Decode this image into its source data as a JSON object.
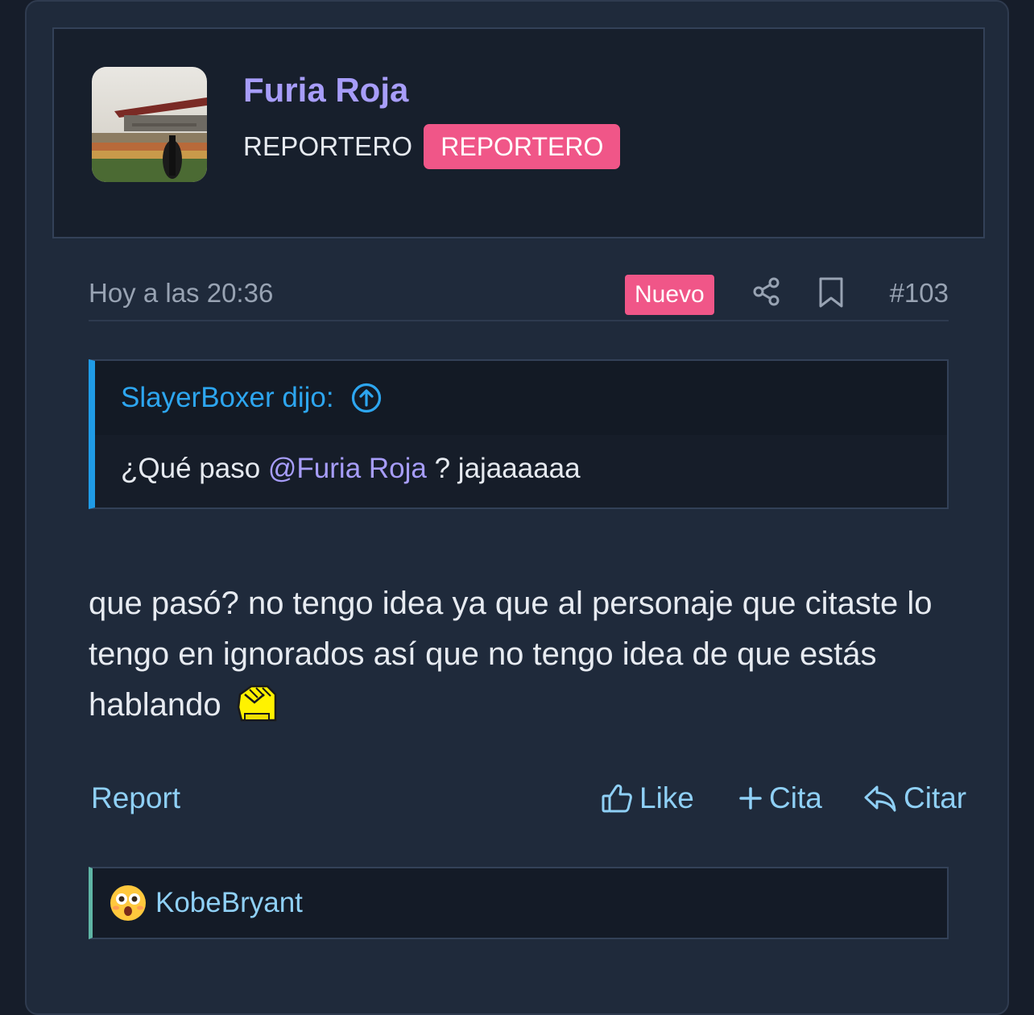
{
  "user": {
    "name": "Furia Roja",
    "title": "REPORTERO",
    "role_badge": "REPORTERO"
  },
  "meta": {
    "timestamp": "Hoy a las 20:36",
    "new_badge": "Nuevo",
    "post_number": "#103",
    "share_icon": "share-icon",
    "bookmark_icon": "bookmark-icon"
  },
  "quote": {
    "author_label": "SlayerBoxer dijo:",
    "jump_icon": "arrow-up-circle-icon",
    "text_before": "¿Qué paso ",
    "mention": "@Furia Roja",
    "text_after": " ? jajaaaaaa"
  },
  "message": {
    "text": "que pasó? no tengo idea ya que al personaje que citaste lo tengo en ignorados así que no tengo idea de que estás hablando",
    "emoji": "facepalm-emoji"
  },
  "actions": {
    "report": "Report",
    "like": "Like",
    "multiquote": "Cita",
    "reply": "Citar"
  },
  "reactions": {
    "emoji": "astonished-face-emoji",
    "users": "KobeBryant"
  },
  "colors": {
    "accent_purple": "#a79dfa",
    "badge_pink": "#f05688",
    "link_blue": "#8fd0f6",
    "quote_blue": "#1f9be6"
  }
}
